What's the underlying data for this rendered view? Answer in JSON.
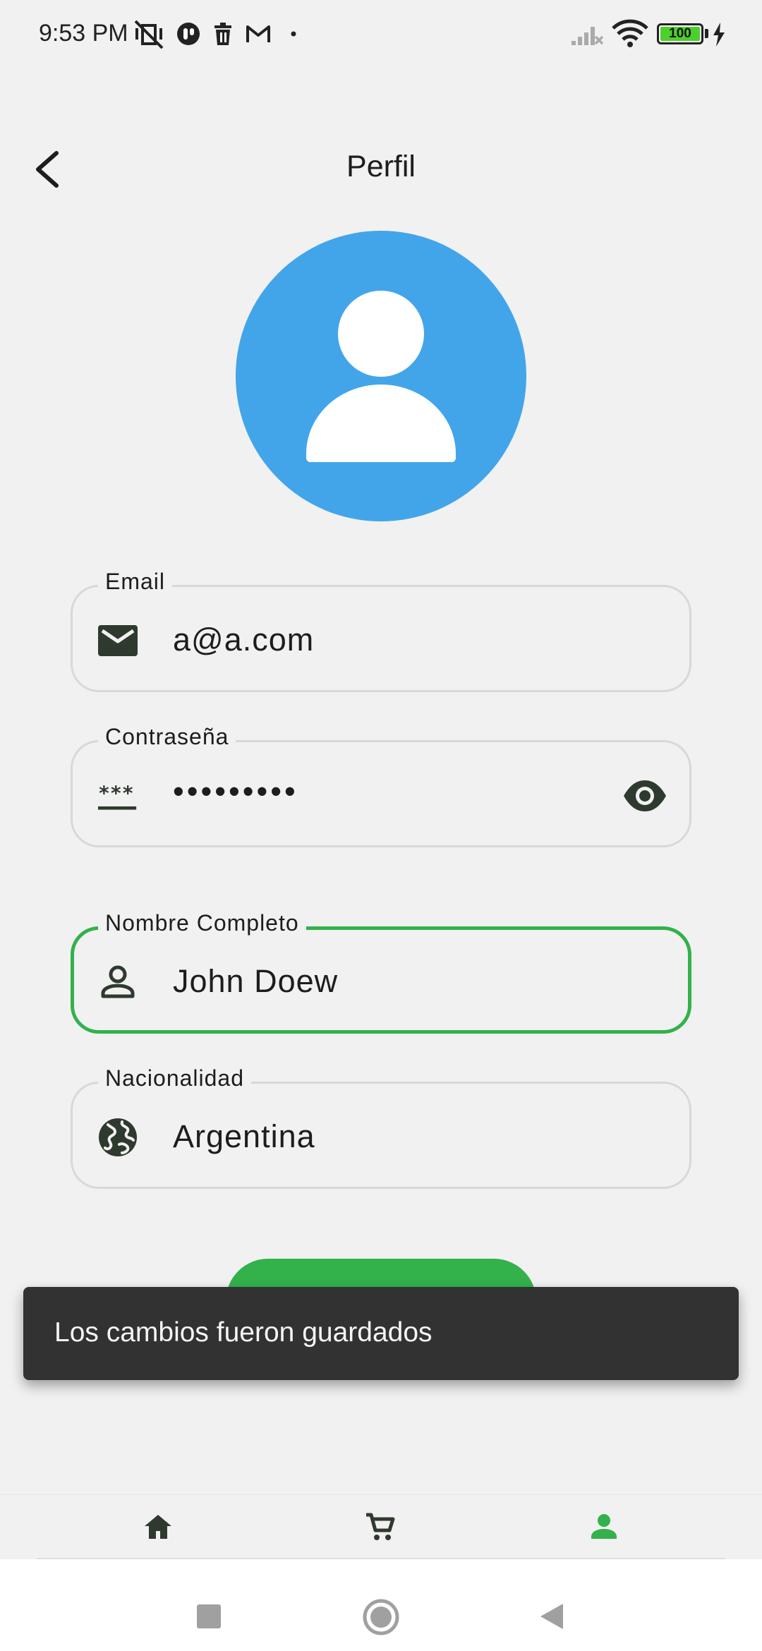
{
  "status_bar": {
    "time": "9:53 PM",
    "battery": "100"
  },
  "header": {
    "title": "Perfil",
    "back_icon": "back-arrow-icon"
  },
  "avatar": {
    "icon": "person-icon",
    "color": "#42a5ea"
  },
  "form": {
    "email": {
      "label": "Email",
      "value": "a@a.com",
      "icon": "mail-icon"
    },
    "password": {
      "label": "Contraseña",
      "value": "•••••••••",
      "icon": "password-icon",
      "trailing_icon": "eye-icon"
    },
    "full_name": {
      "label": "Nombre Completo",
      "value": "John Doew",
      "icon": "person-outline-icon",
      "focused": true
    },
    "nationality": {
      "label": "Nacionalidad",
      "value": "Argentina",
      "icon": "globe-icon"
    }
  },
  "snackbar": {
    "message": "Los cambios fueron guardados"
  },
  "bottom_nav": {
    "items": [
      {
        "icon": "home-icon",
        "active": false
      },
      {
        "icon": "cart-icon",
        "active": false
      },
      {
        "icon": "person-icon",
        "active": true
      }
    ],
    "active_color": "#33b14b"
  },
  "colors": {
    "accent": "#33b14b",
    "avatar_bg": "#42a5ea",
    "snackbar_bg": "#323232"
  }
}
